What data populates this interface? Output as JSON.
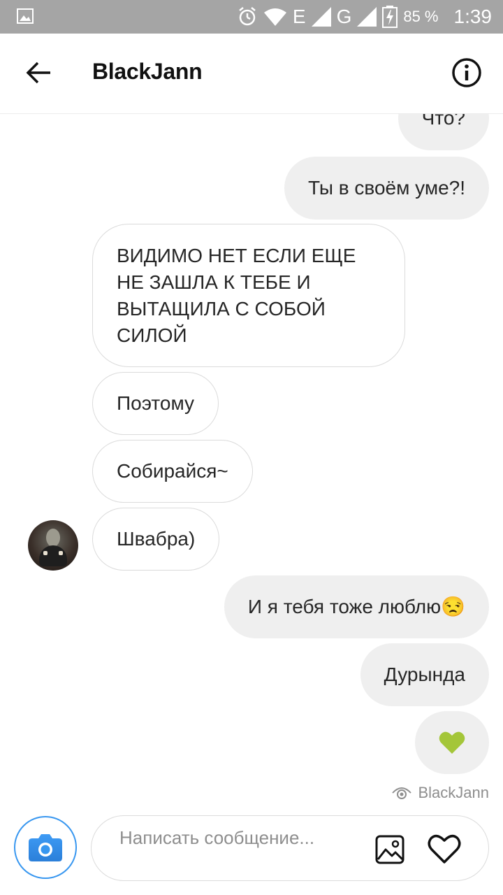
{
  "status_bar": {
    "network_e": "E",
    "network_g": "G",
    "battery": "85 %",
    "time": "1:39"
  },
  "header": {
    "title": "BlackJann"
  },
  "messages": [
    {
      "side": "out",
      "text": "Что?"
    },
    {
      "side": "out",
      "text": "Ты в своём уме?!"
    },
    {
      "side": "in",
      "text": "ВИДИМО НЕТ ЕСЛИ ЕЩЕ НЕ ЗАШЛА К ТЕБЕ И ВЫТАЩИЛА С СОБОЙ СИЛОЙ"
    },
    {
      "side": "in",
      "text": "Поэтому"
    },
    {
      "side": "in",
      "text": "Собирайся~"
    },
    {
      "side": "in",
      "text": "Швабра)"
    },
    {
      "side": "out",
      "text": "И я тебя тоже люблю😒"
    },
    {
      "side": "out",
      "text": "Дурында"
    },
    {
      "side": "out",
      "text": "💚",
      "icon": "green-heart"
    }
  ],
  "seen": {
    "icon": "eye-icon",
    "label": "BlackJann"
  },
  "composer": {
    "placeholder": "Написать сообщение..."
  },
  "colors": {
    "accent": "#3897f0",
    "heart": "#a4c639",
    "outgoing_bubble": "#efefef",
    "status_bar": "#a5a5a5"
  }
}
